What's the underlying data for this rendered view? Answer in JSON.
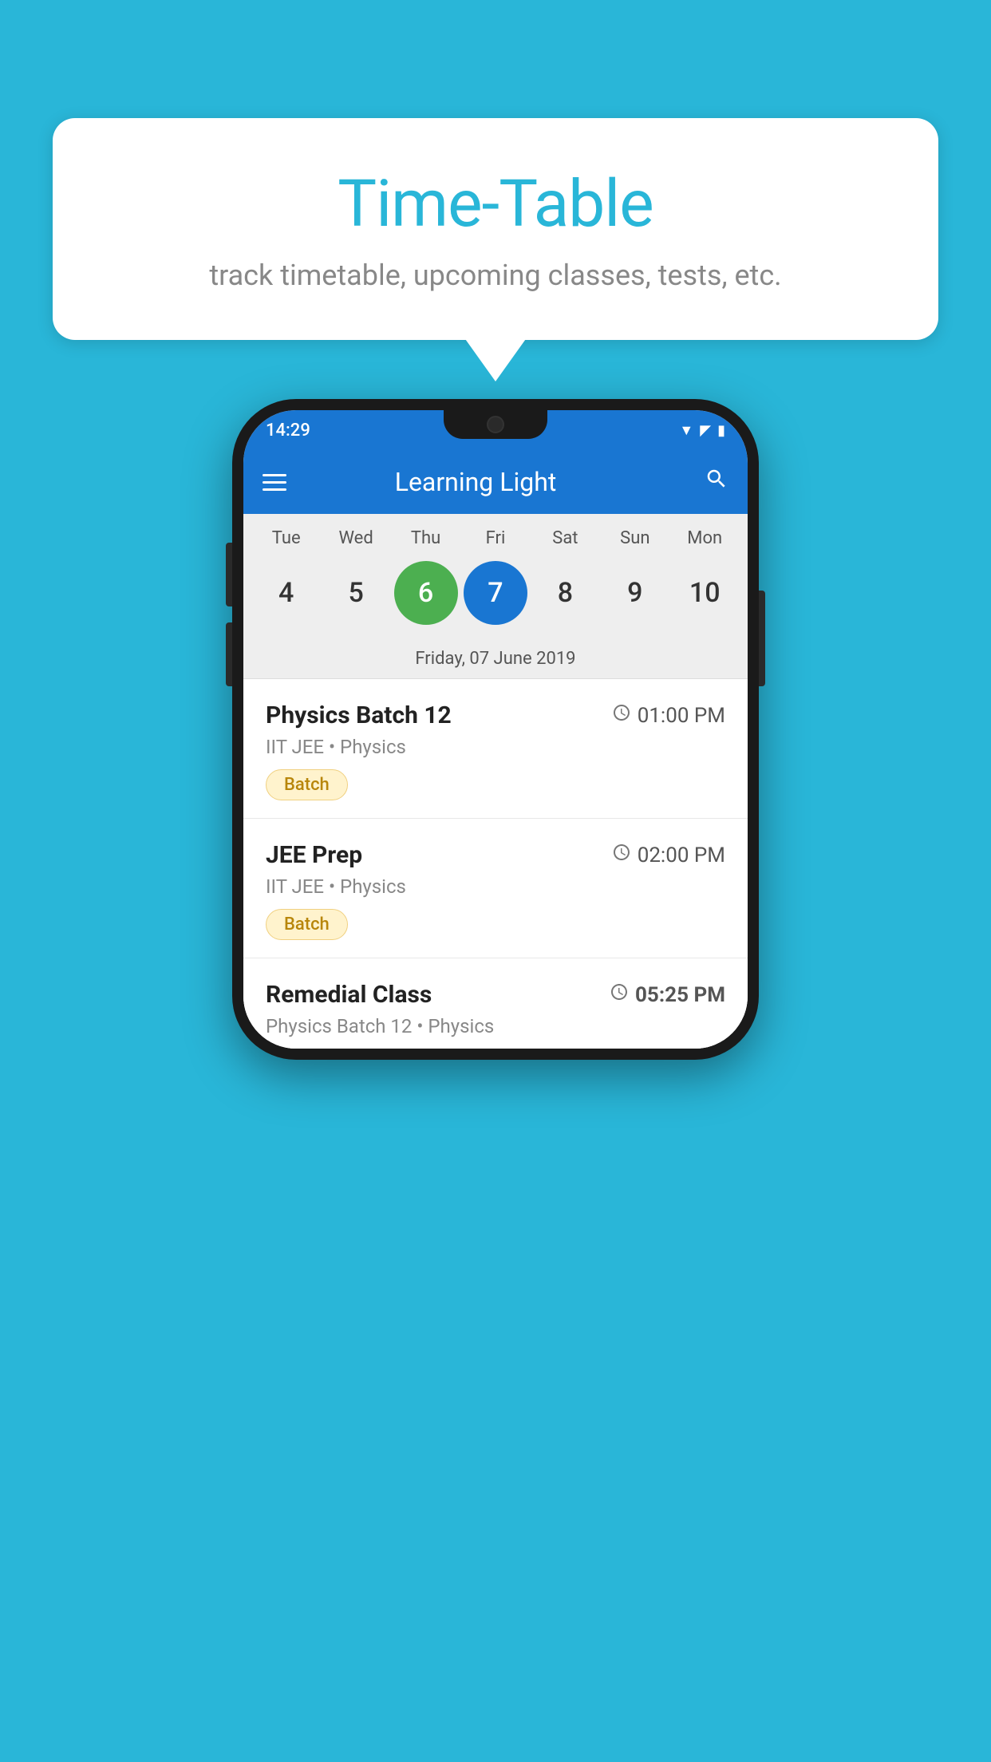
{
  "background_color": "#29b6d8",
  "speech_bubble": {
    "title": "Time-Table",
    "subtitle": "track timetable, upcoming classes, tests, etc."
  },
  "phone": {
    "status_bar": {
      "time": "14:29"
    },
    "app_bar": {
      "title": "Learning Light"
    },
    "calendar": {
      "days": [
        "Tue",
        "Wed",
        "Thu",
        "Fri",
        "Sat",
        "Sun",
        "Mon"
      ],
      "dates": [
        "4",
        "5",
        "6",
        "7",
        "8",
        "9",
        "10"
      ],
      "today_index": 2,
      "selected_index": 3,
      "selected_date_label": "Friday, 07 June 2019"
    },
    "schedule": [
      {
        "title": "Physics Batch 12",
        "time": "01:00 PM",
        "subtitle": "IIT JEE • Physics",
        "badge": "Batch"
      },
      {
        "title": "JEE Prep",
        "time": "02:00 PM",
        "subtitle": "IIT JEE • Physics",
        "badge": "Batch"
      },
      {
        "title": "Remedial Class",
        "time": "05:25 PM",
        "subtitle": "Physics Batch 12 • Physics",
        "badge": null
      }
    ]
  }
}
